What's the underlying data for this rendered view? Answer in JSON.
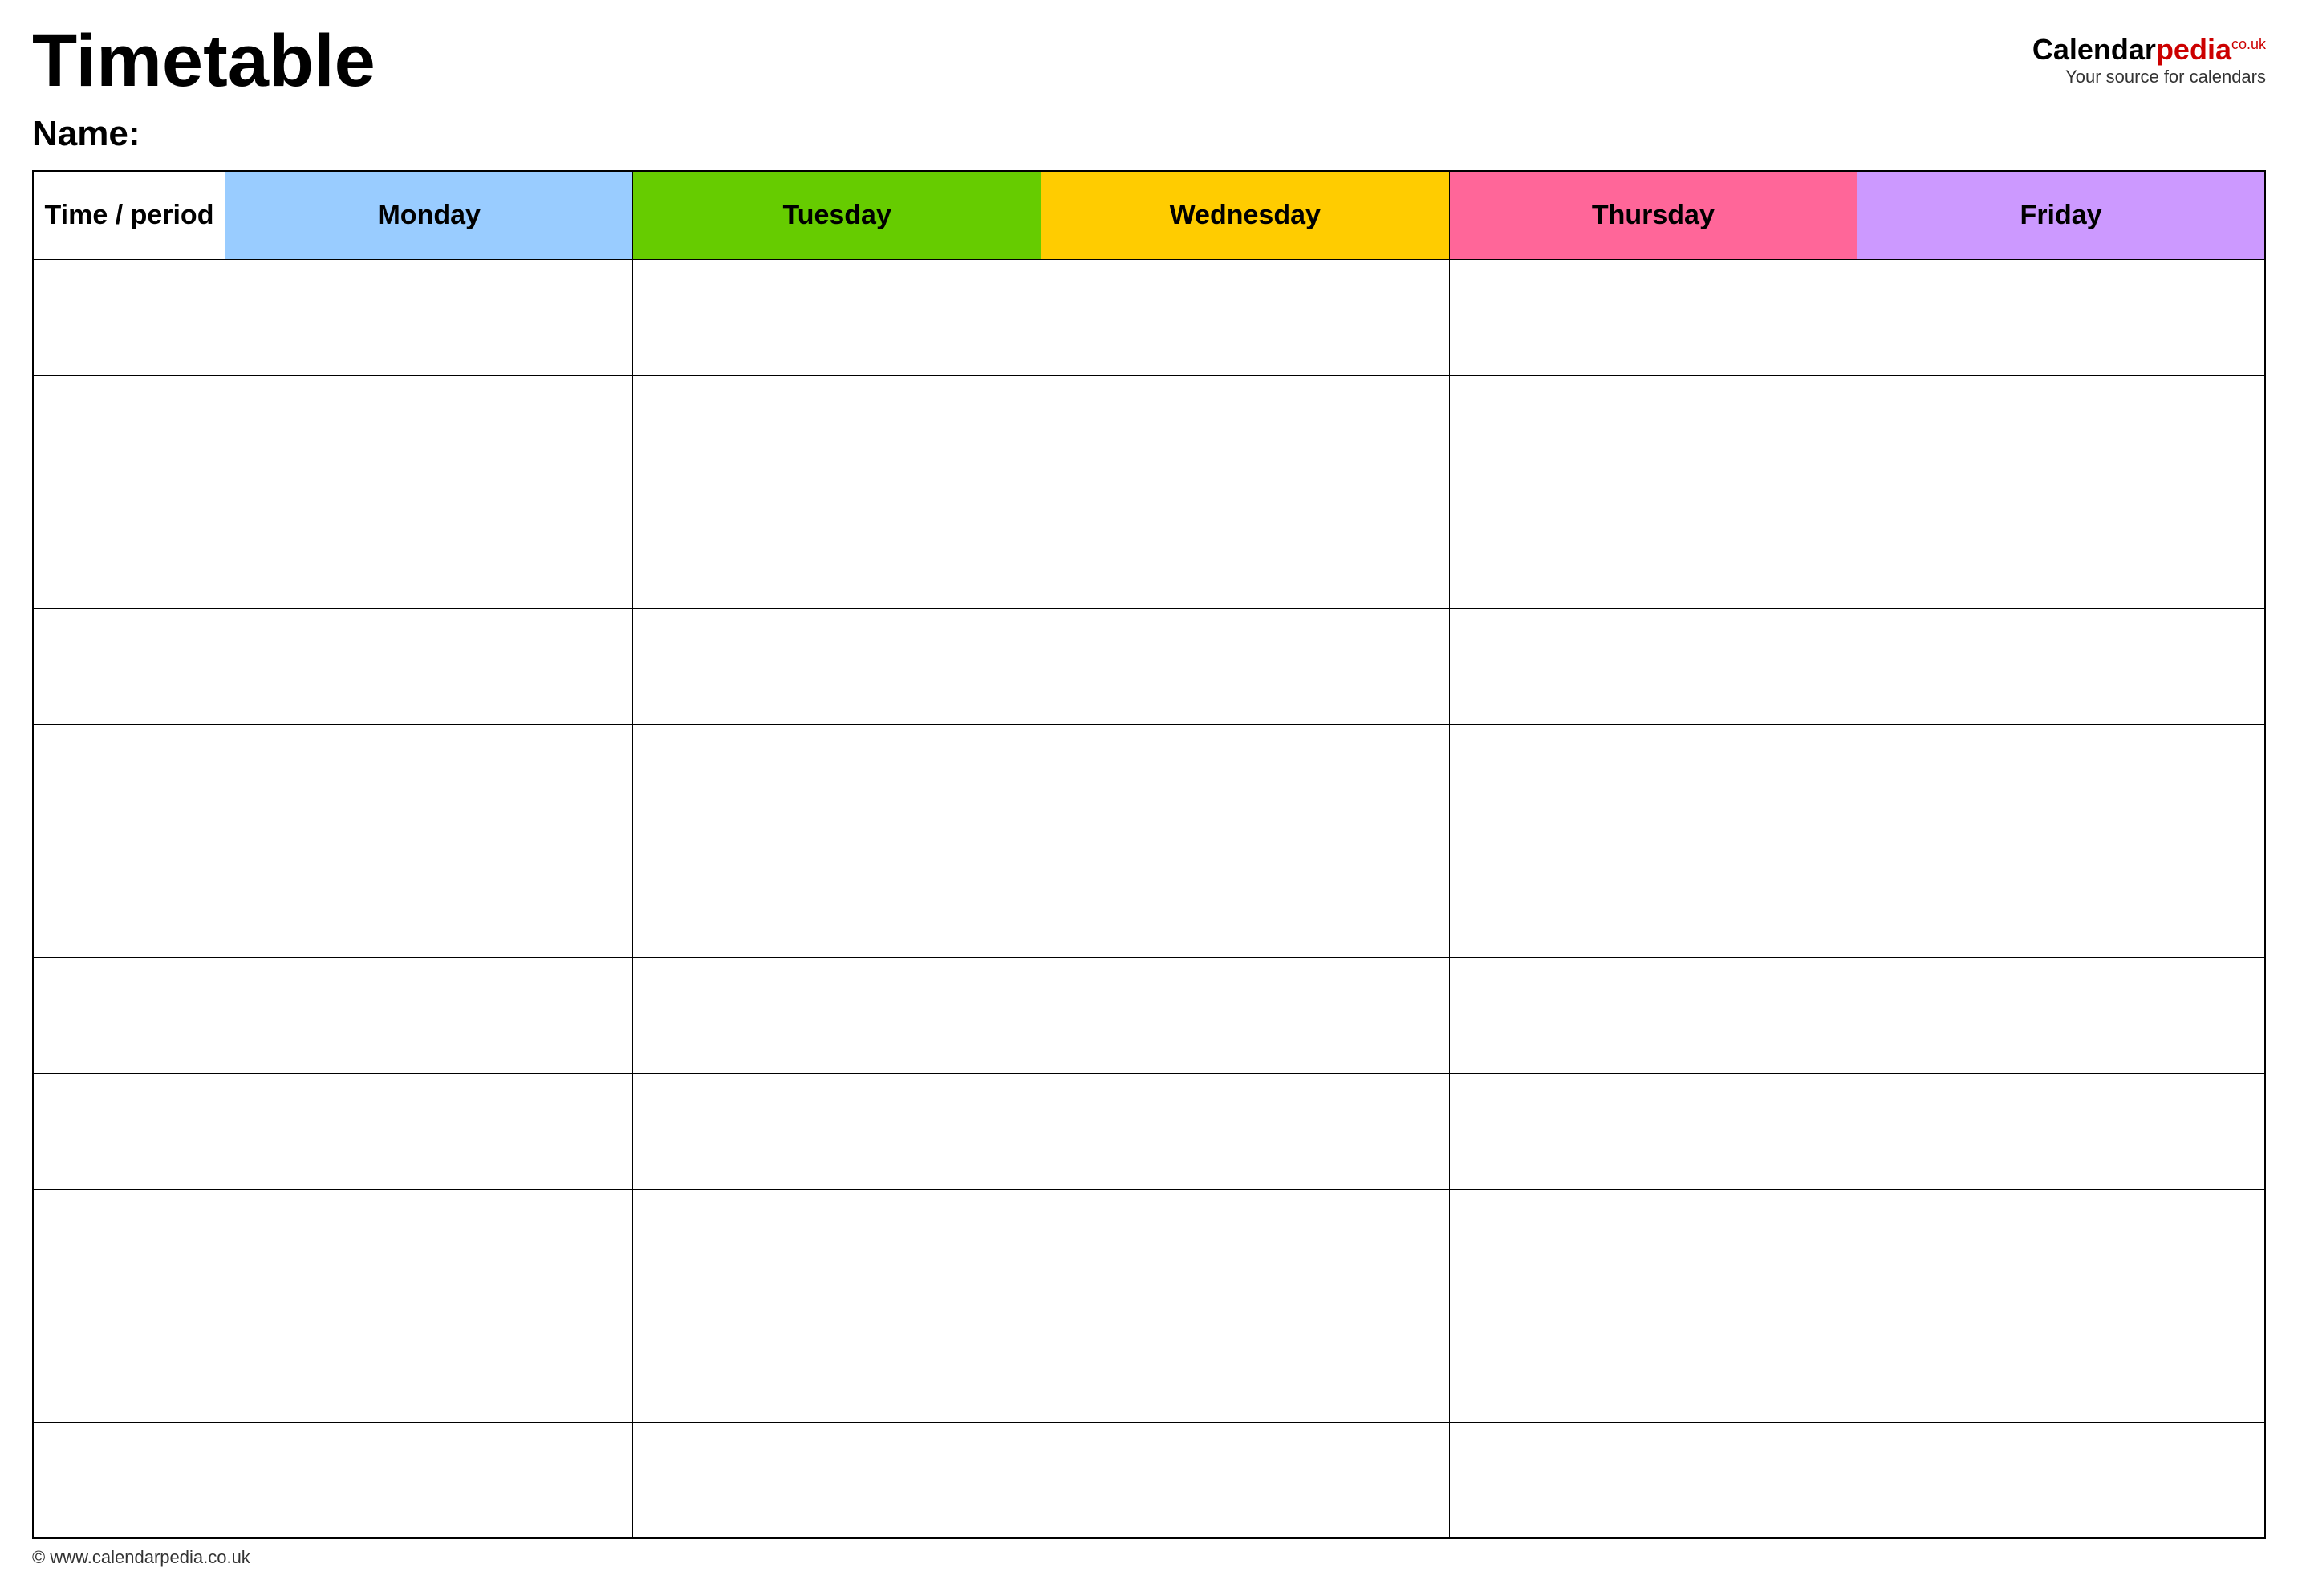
{
  "header": {
    "title": "Timetable",
    "logo": {
      "part1": "Calendar",
      "part2": "pedia",
      "couk": "co.uk",
      "tagline": "Your source for calendars"
    }
  },
  "name_label": "Name:",
  "table": {
    "columns": [
      {
        "label": "Time / period",
        "class": "th-time"
      },
      {
        "label": "Monday",
        "class": "th-monday"
      },
      {
        "label": "Tuesday",
        "class": "th-tuesday"
      },
      {
        "label": "Wednesday",
        "class": "th-wednesday"
      },
      {
        "label": "Thursday",
        "class": "th-thursday"
      },
      {
        "label": "Friday",
        "class": "th-friday"
      }
    ],
    "rows": 11
  },
  "footer": {
    "url": "© www.calendarpedia.co.uk"
  }
}
